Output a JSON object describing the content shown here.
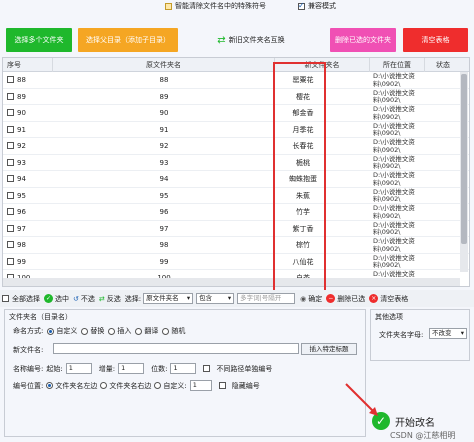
{
  "top_options": {
    "clean_special": "智能清除文件名中的特殊符号",
    "compat_mode": "兼容模式"
  },
  "toolbar": {
    "select_folders": "选择多个文件夹",
    "select_parent": "选择父目录（添加子目录）",
    "compare": "新旧文件夹名互换",
    "delete_selected": "删除已选的文件夹",
    "clear_list": "清空表格"
  },
  "table": {
    "headers": [
      "序号",
      "原文件夹名",
      "新文件夹名",
      "所在位置",
      "状态"
    ],
    "rows": [
      {
        "no": "88",
        "orig": "88",
        "new": "罂粟花",
        "loc": "D:\\小说推文资料\\0902\\"
      },
      {
        "no": "89",
        "orig": "89",
        "new": "樱花",
        "loc": "D:\\小说推文资料\\0902\\"
      },
      {
        "no": "90",
        "orig": "90",
        "new": "郁金香",
        "loc": "D:\\小说推文资料\\0902\\"
      },
      {
        "no": "91",
        "orig": "91",
        "new": "月季花",
        "loc": "D:\\小说推文资料\\0902\\"
      },
      {
        "no": "92",
        "orig": "92",
        "new": "长春花",
        "loc": "D:\\小说推文资料\\0902\\"
      },
      {
        "no": "93",
        "orig": "93",
        "new": "栀桃",
        "loc": "D:\\小说推文资料\\0902\\"
      },
      {
        "no": "94",
        "orig": "94",
        "new": "蜘蛛抱蛋",
        "loc": "D:\\小说推文资料\\0902\\"
      },
      {
        "no": "95",
        "orig": "95",
        "new": "朱蕉",
        "loc": "D:\\小说推文资料\\0902\\"
      },
      {
        "no": "96",
        "orig": "96",
        "new": "竹芋",
        "loc": "D:\\小说推文资料\\0902\\"
      },
      {
        "no": "97",
        "orig": "97",
        "new": "紫丁香",
        "loc": "D:\\小说推文资料\\0902\\"
      },
      {
        "no": "98",
        "orig": "98",
        "new": "棕竹",
        "loc": "D:\\小说推文资料\\0902\\"
      },
      {
        "no": "99",
        "orig": "99",
        "new": "八仙花",
        "loc": "D:\\小说推文资料\\0902\\"
      },
      {
        "no": "100",
        "orig": "100",
        "new": "白茶",
        "loc": "D:\\小说推文资料\\0902\\"
      }
    ]
  },
  "selbar": {
    "select_all": "全部选择",
    "select": "选中",
    "unselect": "不选",
    "invert": "反选",
    "choose_label": "选择:",
    "col_option": "原文件夹名",
    "match_option": "包含",
    "keyword_placeholder": "多字词|号隔开",
    "confirm": "确定",
    "delete_selected": "删除已选",
    "clear_table": "清空表格"
  },
  "rename_panel": {
    "title": "文件夹名（目录名）",
    "mode_label": "命名方式:",
    "modes": [
      "自定义",
      "替换",
      "插入",
      "翻译",
      "随机"
    ],
    "new_name_label": "新文件名:",
    "insert_btn": "插入特定标题",
    "num_label": "名称编号:",
    "start_label": "起始:",
    "start_val": "1",
    "step_label": "增量:",
    "step_val": "1",
    "digits_label": "位数:",
    "digits_val": "1",
    "no_zero": "不同路径单独编号",
    "pos_label": "编号位置:",
    "pos_left": "文件夹名左边",
    "pos_right": "文件夹名右边",
    "pos_custom": "自定义:",
    "pos_custom_val": "1",
    "hide_num": "隐藏编号"
  },
  "other_panel": {
    "title": "其他选项",
    "case_label": "文件夹名字母:",
    "case_value": "不改变"
  },
  "start": {
    "label": "开始改名"
  },
  "watermark": "CSDN @江慈相明",
  "colors": {
    "green": "#1fb82c",
    "orange": "#f5a623",
    "red": "#ef2d2d",
    "pink": "#f050b4",
    "highlight": "#e03030"
  }
}
